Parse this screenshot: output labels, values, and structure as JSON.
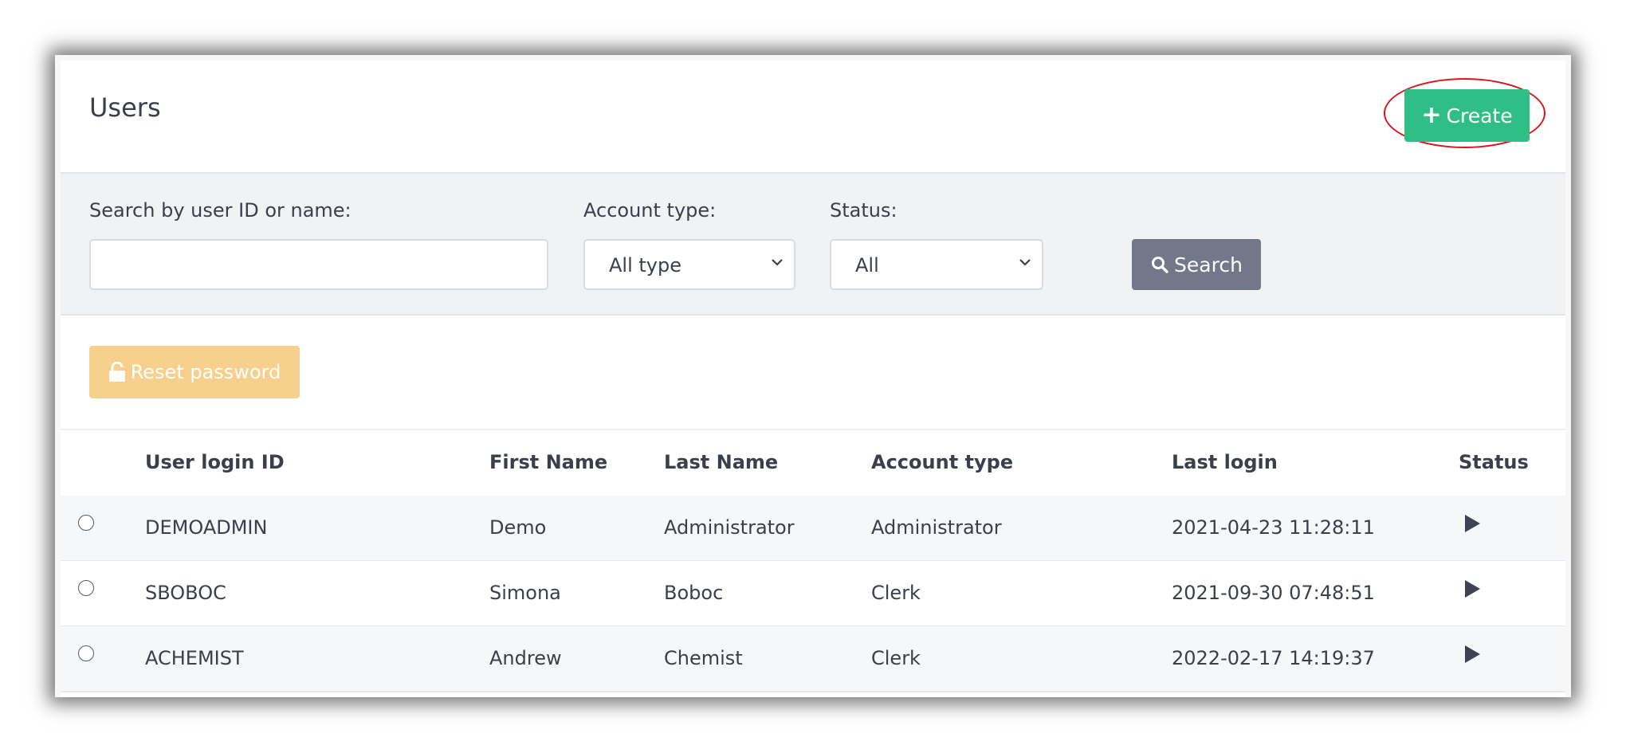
{
  "header": {
    "title": "Users",
    "create_label": "Create"
  },
  "filters": {
    "search_label": "Search by user ID or name:",
    "search_value": "",
    "account_type_label": "Account type:",
    "account_type_value": "All type",
    "status_label": "Status:",
    "status_value": "All",
    "search_button_label": "Search"
  },
  "toolbar": {
    "reset_password_label": "Reset password"
  },
  "table": {
    "columns": [
      "User login ID",
      "First Name",
      "Last Name",
      "Account type",
      "Last login",
      "Status"
    ],
    "rows": [
      {
        "login_id": "DEMOADMIN",
        "first_name": "Demo",
        "last_name": "Administrator",
        "account_type": "Administrator",
        "last_login": "2021-04-23 11:28:11",
        "status_icon": "play-icon"
      },
      {
        "login_id": "SBOBOC",
        "first_name": "Simona",
        "last_name": "Boboc",
        "account_type": "Clerk",
        "last_login": "2021-09-30 07:48:51",
        "status_icon": "play-icon"
      },
      {
        "login_id": "ACHEMIST",
        "first_name": "Andrew",
        "last_name": "Chemist",
        "account_type": "Clerk",
        "last_login": "2022-02-17 14:19:37",
        "status_icon": "play-icon"
      }
    ]
  },
  "colors": {
    "create_button": "#2fbf86",
    "search_button": "#727889",
    "reset_button": "#f7d08e",
    "highlight_ring": "#d9161d"
  }
}
